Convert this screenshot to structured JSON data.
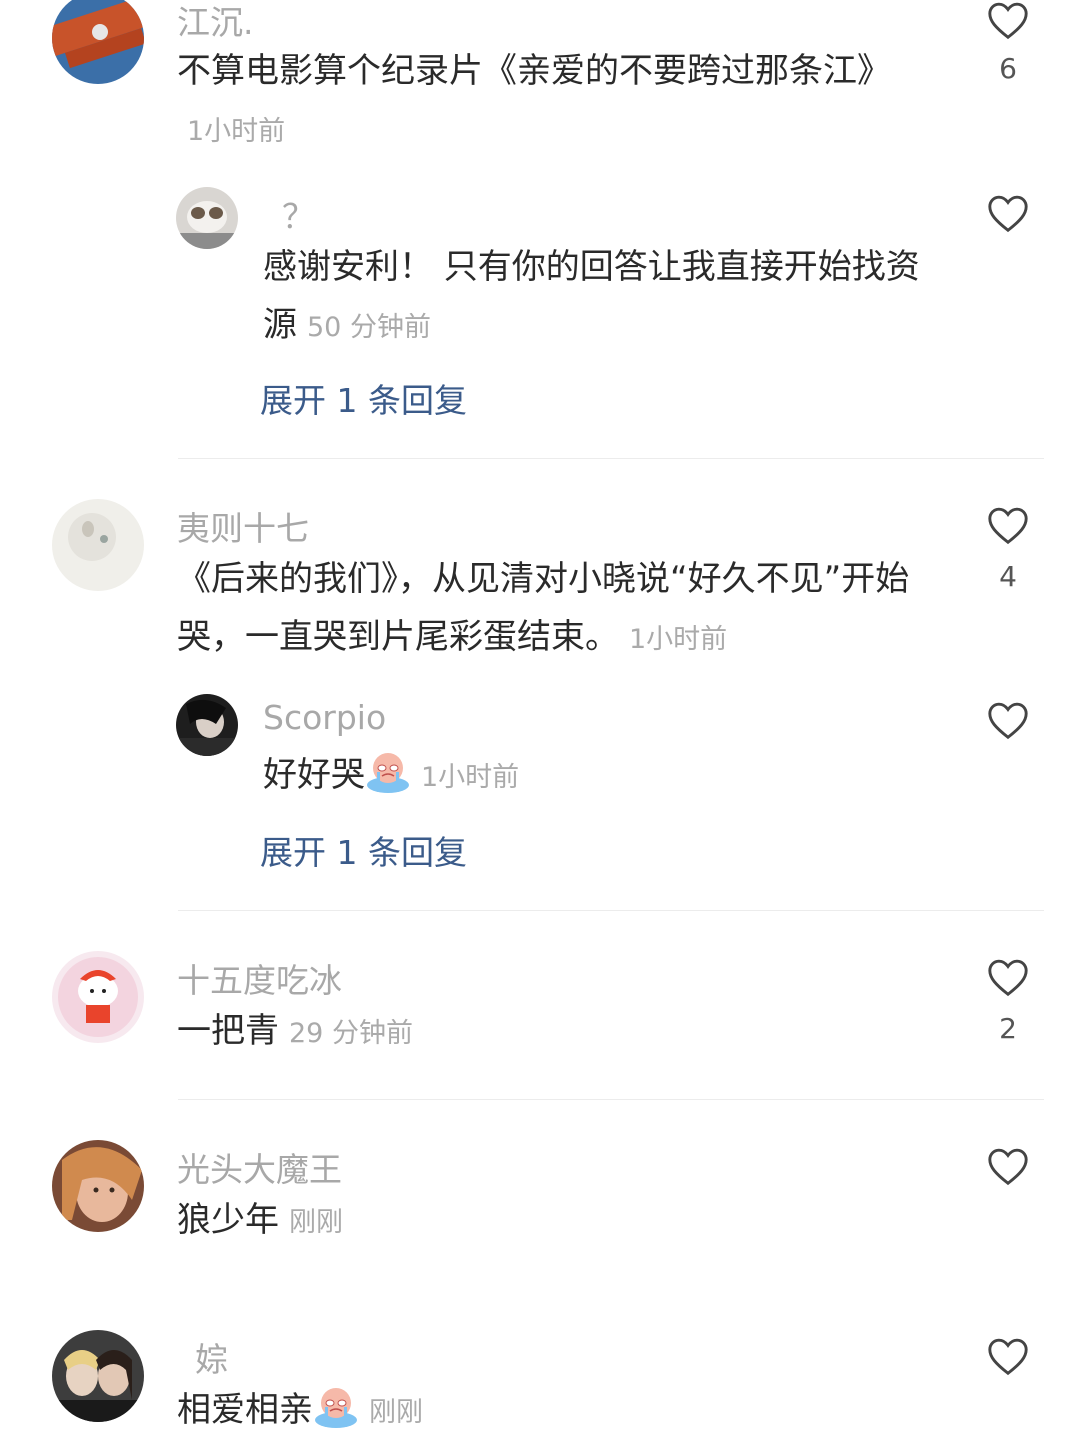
{
  "comments": [
    {
      "username": "江沉.",
      "text": "不算电影算个纪录片《亲爱的不要跨过那条江》",
      "time": "1小时前",
      "likes": "6",
      "reply": {
        "username": "？",
        "text": "感谢安利！ 只有你的回答让我直接开始找资源",
        "time": "50 分钟前"
      },
      "expand_label": "展开 1 条回复"
    },
    {
      "username": "夷则十七",
      "text": "《后来的我们》，从见清对小晓说“好久不见”开始哭，一直哭到片尾彩蛋结束。",
      "time": "1小时前",
      "likes": "4",
      "reply": {
        "username": "Scorpio",
        "text": "好好哭",
        "time": "1小时前"
      },
      "expand_label": "展开 1 条回复"
    },
    {
      "username": "十五度吃冰",
      "text": "一把青",
      "time": "29 分钟前",
      "likes": "2"
    },
    {
      "username": "光头大魔王",
      "text": "狼少年",
      "time": "刚刚",
      "likes": ""
    },
    {
      "username": "婃",
      "text": "相爱相亲",
      "time": "刚刚",
      "likes": ""
    }
  ],
  "icons": {
    "like": "heart-outline-icon",
    "cry_emoji": "crying-emoji-icon"
  },
  "colors": {
    "username": "#a8a8a8",
    "time": "#aaaaaa",
    "expand_link": "#3b5b8a"
  }
}
